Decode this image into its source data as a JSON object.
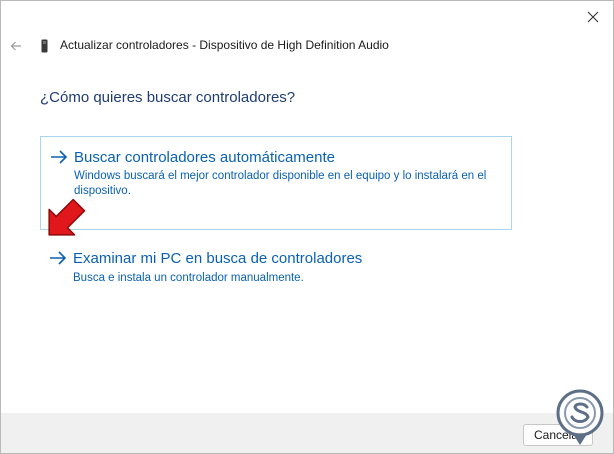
{
  "window": {
    "title": "Actualizar controladores - Dispositivo de High Definition Audio",
    "icons": {
      "back": "back-arrow-icon",
      "close": "close-icon",
      "device": "device-driver-icon"
    }
  },
  "heading": "¿Cómo quieres buscar controladores?",
  "options": [
    {
      "title": "Buscar controladores automáticamente",
      "description": "Windows buscará el mejor controlador disponible en el equipo y lo instalará en el dispositivo.",
      "icon": "arrow-right-icon",
      "selected": true
    },
    {
      "title": "Examinar mi PC en busca de controladores",
      "description": "Busca e instala un controlador manualmente.",
      "icon": "arrow-right-icon",
      "selected": false
    }
  ],
  "footer": {
    "cancel_label": "Cancelar"
  },
  "overlay": {
    "pointer": "red-pointer-arrow-icon",
    "watermark": "site-logo-watermark"
  },
  "colors": {
    "heading": "#1f3d72",
    "link": "#0a61b3",
    "selection_border": "#a7d6ee",
    "pointer": "#e0181c",
    "footer_bg": "#f0f0f0"
  }
}
